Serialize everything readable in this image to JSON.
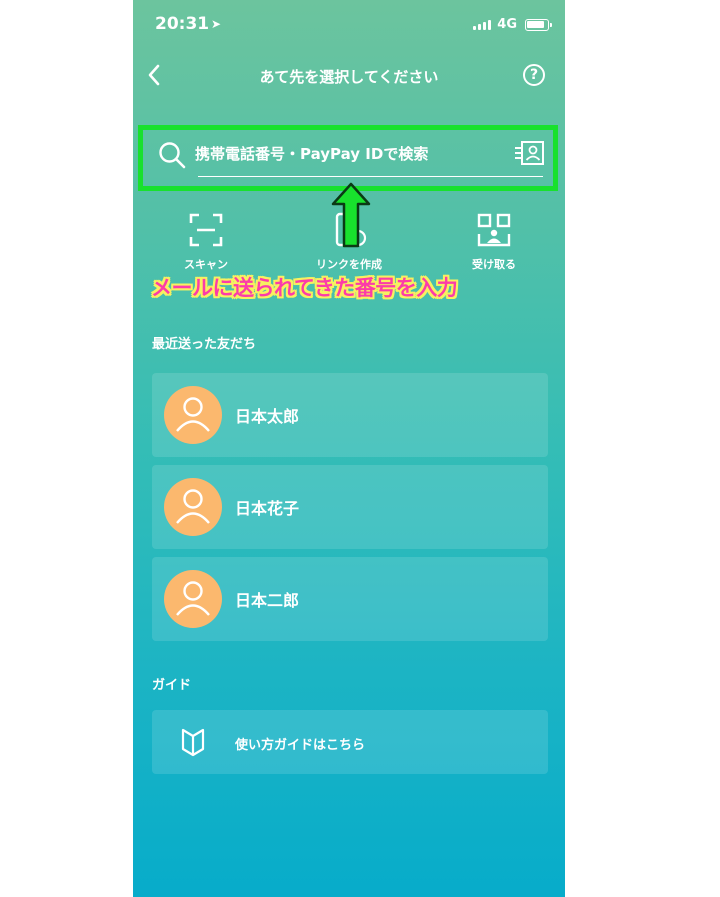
{
  "status_bar": {
    "time": "20:31",
    "network": "4G"
  },
  "header": {
    "title": "あて先を選択してください",
    "help_label": "?"
  },
  "search": {
    "placeholder": "携帯電話番号・PayPay IDで検索"
  },
  "actions": [
    {
      "label": "スキャン",
      "icon": "scan-icon"
    },
    {
      "label": "リンクを作成",
      "icon": "link-icon"
    },
    {
      "label": "受け取る",
      "icon": "qr-receive-icon"
    }
  ],
  "annotation": {
    "text": "メールに送られてきた番号を入力",
    "color": "#fc3ba9",
    "outline": "#f7f060",
    "highlight": "#18e12d"
  },
  "recent": {
    "title": "最近送った友だち",
    "friends": [
      {
        "name": "日本太郎"
      },
      {
        "name": "日本花子"
      },
      {
        "name": "日本二郎"
      }
    ]
  },
  "guide": {
    "title": "ガイド",
    "link_label": "使い方ガイドはこちら"
  },
  "colors": {
    "avatar": "#fbb86e",
    "gradient_top": "#6cc49e",
    "gradient_bottom": "#07acca"
  }
}
